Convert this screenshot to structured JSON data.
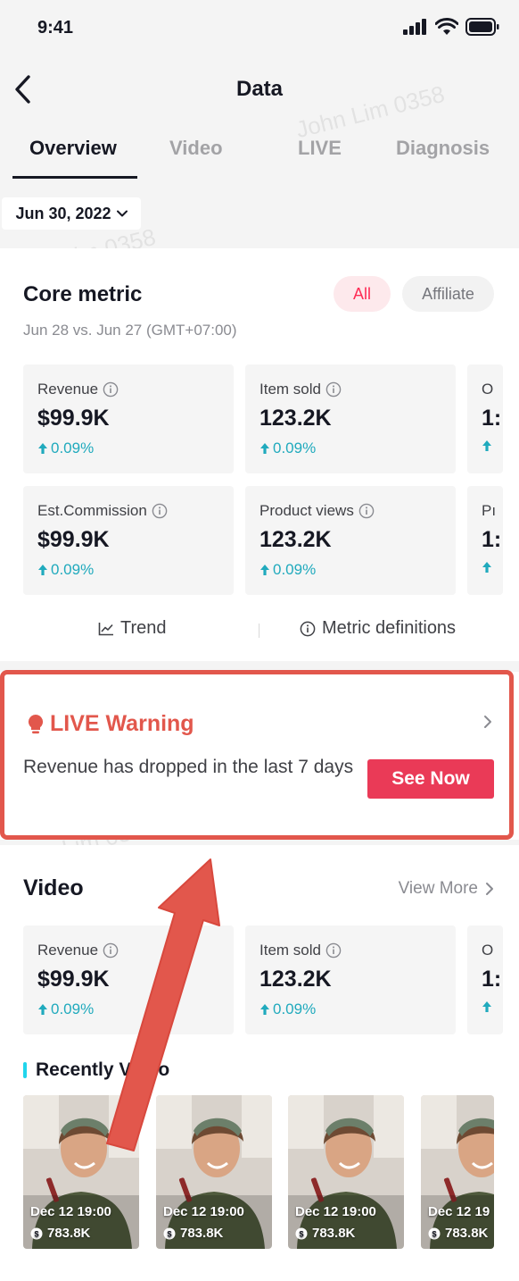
{
  "status_bar": {
    "time": "9:41"
  },
  "header": {
    "title": "Data"
  },
  "tabs": [
    {
      "label": "Overview",
      "active": true
    },
    {
      "label": "Video",
      "active": false
    },
    {
      "label": "LIVE",
      "active": false
    },
    {
      "label": "Diagnosis",
      "active": false
    }
  ],
  "date_filter": {
    "label": "Jun 30, 2022"
  },
  "core_metric": {
    "title": "Core metric",
    "filters": [
      {
        "label": "All",
        "selected": true
      },
      {
        "label": "Affiliate",
        "selected": false
      }
    ],
    "comparison": "Jun 28 vs. Jun 27 (GMT+07:00)",
    "metrics": [
      {
        "label": "Revenue",
        "value": "$99.9K",
        "delta": "0.09%"
      },
      {
        "label": "Item sold",
        "value": "123.2K",
        "delta": "0.09%"
      },
      {
        "label": "O",
        "value": "1:",
        "delta": ""
      },
      {
        "label": "Est.Commission",
        "value": "$99.9K",
        "delta": "0.09%"
      },
      {
        "label": "Product views",
        "value": "123.2K",
        "delta": "0.09%"
      },
      {
        "label": "Pı",
        "value": "1:",
        "delta": ""
      }
    ],
    "trend_label": "Trend",
    "definitions_label": "Metric definitions"
  },
  "live_warning": {
    "title": "LIVE Warning",
    "message": "Revenue has dropped in the last 7 days",
    "button": "See Now"
  },
  "video_section": {
    "title": "Video",
    "view_more": "View More",
    "metrics": [
      {
        "label": "Revenue",
        "value": "$99.9K",
        "delta": "0.09%"
      },
      {
        "label": "Item sold",
        "value": "123.2K",
        "delta": "0.09%"
      },
      {
        "label": "O",
        "value": "1:",
        "delta": ""
      }
    ],
    "recent_heading": "Recently Video",
    "videos": [
      {
        "date": "Dec 12 19:00",
        "views": "783.8K"
      },
      {
        "date": "Dec 12 19:00",
        "views": "783.8K"
      },
      {
        "date": "Dec 12 19:00",
        "views": "783.8K"
      },
      {
        "date": "Dec 12 19",
        "views": "783.8K"
      }
    ]
  },
  "watermark": "John Lim 0358",
  "colors": {
    "accent": "#fe2c55",
    "warning": "#e2574c",
    "delta": "#20aabd",
    "button": "#ea3a57"
  }
}
